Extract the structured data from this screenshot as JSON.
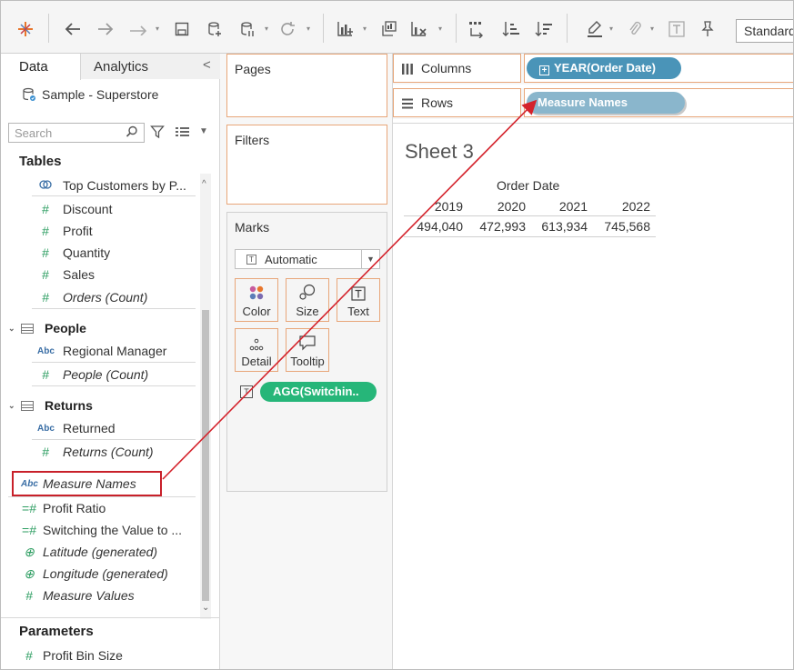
{
  "toolbar": {
    "standard_label": "Standard",
    "icons": [
      "tableau-logo-icon",
      "back-icon",
      "forward-icon",
      "redo-icon",
      "save-icon",
      "new-datasource-icon",
      "pause-updates-icon",
      "refresh-icon",
      "new-sheet-icon",
      "duplicate-sheet-icon",
      "clear-sheet-icon",
      "swap-icon",
      "sort-ascending-icon",
      "sort-descending-icon",
      "highlight-icon",
      "attach-icon",
      "text-icon",
      "pin-icon"
    ]
  },
  "data_pane": {
    "tab_data": "Data",
    "tab_analytics": "Analytics",
    "collapse": "<",
    "datasource": "Sample - Superstore",
    "search_placeholder": "Search",
    "tables_title": "Tables",
    "parameters_title": "Parameters",
    "fields": {
      "top_customers": "Top Customers by P...",
      "discount": "Discount",
      "profit": "Profit",
      "quantity": "Quantity",
      "sales": "Sales",
      "orders_count": "Orders (Count)",
      "people_group": "People",
      "regional_manager": "Regional Manager",
      "people_count": "People (Count)",
      "returns_group": "Returns",
      "returned": "Returned",
      "returns_count": "Returns (Count)",
      "measure_names": "Measure Names",
      "profit_ratio": "Profit Ratio",
      "switching": "Switching the Value to ...",
      "latitude": "Latitude (generated)",
      "longitude": "Longitude (generated)",
      "measure_values": "Measure Values",
      "profit_bin_size": "Profit Bin Size"
    },
    "abc": "Abc"
  },
  "cards": {
    "pages": "Pages",
    "filters": "Filters",
    "marks": "Marks",
    "marks_type": "Automatic",
    "marks_buttons": {
      "color": "Color",
      "size": "Size",
      "text": "Text",
      "detail": "Detail",
      "tooltip": "Tooltip"
    },
    "agg_pill": "AGG(Switchin.."
  },
  "shelves": {
    "columns_label": "Columns",
    "rows_label": "Rows",
    "columns_pill": "YEAR(Order Date)",
    "rows_pill": "Measure Names"
  },
  "view": {
    "sheet_title": "Sheet 3",
    "header": "Order Date",
    "years": [
      "2019",
      "2020",
      "2021",
      "2022"
    ],
    "values": [
      "494,040",
      "472,993",
      "613,934",
      "745,568"
    ]
  },
  "colors": {
    "highlight_box": "#c8202a",
    "arrow": "#d4232c",
    "pill_blue": "#4a94b8",
    "pill_green": "#26b679",
    "shelf_border": "#e8a679"
  }
}
